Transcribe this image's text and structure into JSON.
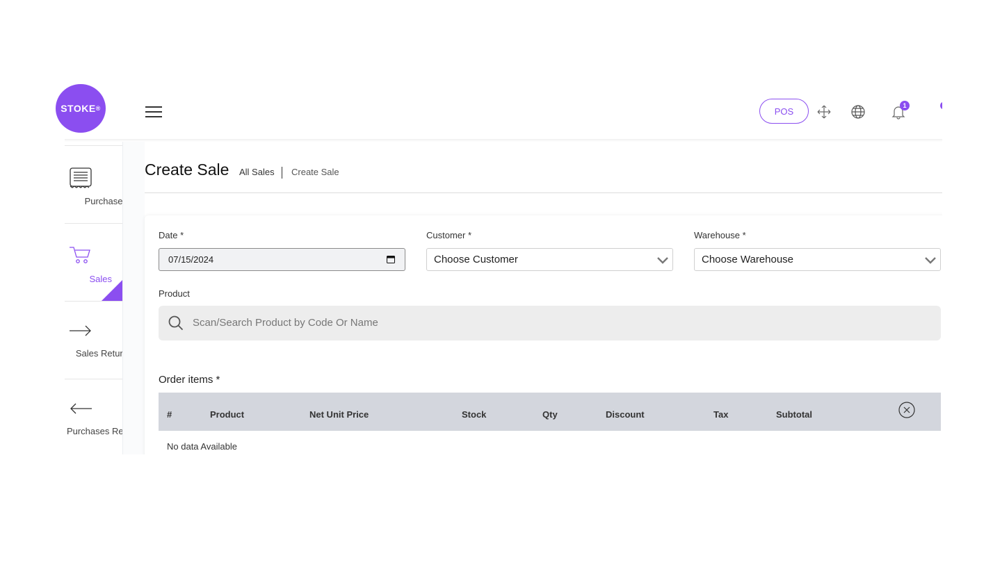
{
  "brand": {
    "name": "STOKE",
    "mark": "®"
  },
  "header": {
    "pos_label": "POS",
    "notification_count": "1",
    "icons": [
      "menu-icon",
      "fullscreen-icon",
      "globe-icon",
      "bell-icon"
    ]
  },
  "sidebar": {
    "items": [
      {
        "label": "Purchases",
        "icon": "receipt-icon",
        "active": false
      },
      {
        "label": "Sales",
        "icon": "cart-icon",
        "active": true
      },
      {
        "label": "Sales Return",
        "icon": "arrow-right-icon",
        "active": false
      },
      {
        "label": "Purchases Return",
        "icon": "arrow-left-icon",
        "active": false
      }
    ]
  },
  "page": {
    "title": "Create Sale",
    "breadcrumb": {
      "parent": "All Sales",
      "current": "Create Sale"
    }
  },
  "form": {
    "date": {
      "label": "Date *",
      "value": "07/15/2024"
    },
    "customer": {
      "label": "Customer *",
      "value": "Choose Customer"
    },
    "warehouse": {
      "label": "Warehouse *",
      "value": "Choose Warehouse"
    },
    "product": {
      "label": "Product",
      "placeholder": "Scan/Search Product by Code Or Name"
    }
  },
  "order": {
    "title": "Order items *",
    "columns": [
      "#",
      "Product",
      "Net Unit Price",
      "Stock",
      "Qty",
      "Discount",
      "Tax",
      "Subtotal"
    ],
    "empty_text": "No data Available"
  },
  "colors": {
    "accent": "#8b4ef0",
    "table_header": "#d3d6dd",
    "search_bg": "#ededed"
  }
}
